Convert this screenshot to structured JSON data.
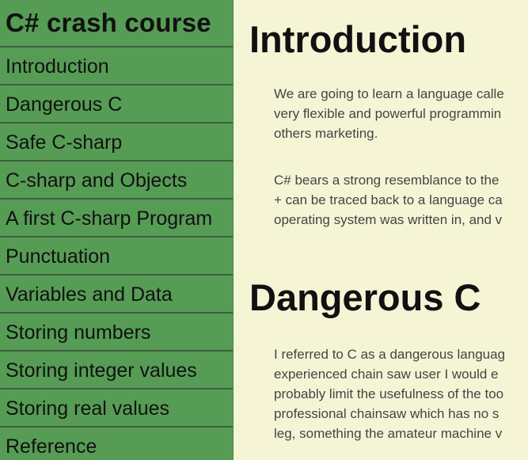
{
  "sidebar": {
    "title": "C# crash course",
    "items": [
      {
        "label": "Introduction"
      },
      {
        "label": "Dangerous C"
      },
      {
        "label": "Safe C-sharp"
      },
      {
        "label": "C-sharp and Objects"
      },
      {
        "label": "A first C-sharp Program"
      },
      {
        "label": "Punctuation"
      },
      {
        "label": "Variables and Data"
      },
      {
        "label": "Storing numbers"
      },
      {
        "label": "Storing integer values"
      },
      {
        "label": "Storing real values"
      },
      {
        "label": "Reference"
      }
    ]
  },
  "main": {
    "sections": [
      {
        "heading": "Introduction",
        "paragraphs": [
          {
            "lines": [
              "We are going to learn a language calle",
              "very flexible and powerful programmin",
              "others marketing."
            ]
          },
          {
            "lines": [
              "C# bears a strong resemblance to the",
              "+ can be traced back to a language ca",
              "operating system was written in, and v"
            ]
          }
        ]
      },
      {
        "heading": "Dangerous C",
        "paragraphs": [
          {
            "lines": [
              "I referred to C as a dangerous languag",
              "experienced chain saw user I would e",
              "probably limit the usefulness of the too",
              "professional chainsaw which has no s",
              "leg, something the amateur machine v"
            ]
          }
        ]
      }
    ]
  },
  "colors": {
    "sidebar_bg": "#569c55",
    "content_bg": "#f5f5d6",
    "divider": "#3f5f3e"
  }
}
